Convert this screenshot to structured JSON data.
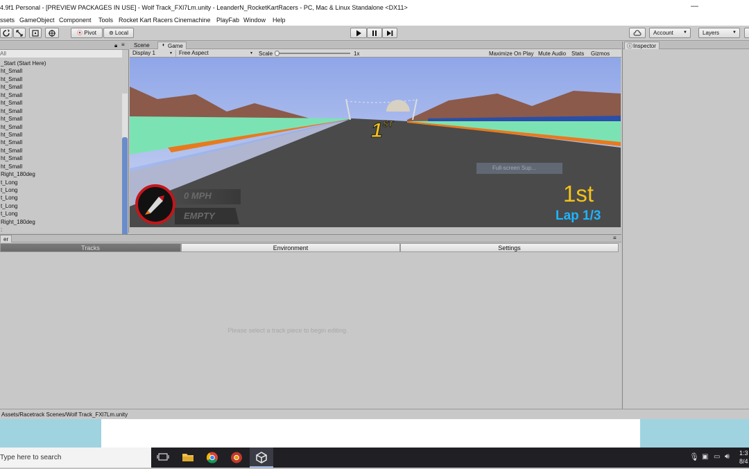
{
  "window": {
    "title": "4.9f1 Personal - [PREVIEW PACKAGES IN USE] - Wolf Track_FXl7Lm.unity - LeanderN_RocketKartRacers - PC, Mac & Linux Standalone <DX11>",
    "minimize": "—"
  },
  "menu": [
    "ssets",
    "GameObject",
    "Component",
    "Tools",
    "Rocket Kart Racers",
    "Cinemachine",
    "PlayFab",
    "Window",
    "Help"
  ],
  "toolbar": {
    "pivot_label": "Pivot",
    "local_label": "Local",
    "account_label": "Account",
    "layers_label": "Layers"
  },
  "hierarchy": {
    "search_text": "All",
    "items": [
      "_Start (Start Here)",
      "ht_Small",
      "ht_Small",
      "ht_Small",
      "ht_Small",
      "ht_Small",
      "ht_Small",
      "ht_Small",
      "ht_Small",
      "ht_Small",
      "ht_Small",
      "ht_Small",
      "ht_Small",
      "ht_Small",
      "Right_180deg",
      "t_Long",
      "t_Long",
      "t_Long",
      "t_Long",
      "t_Long",
      "Right_180deg",
      ":"
    ]
  },
  "game_view": {
    "tab_scene": "Scene",
    "tab_game": "Game",
    "display": "Display 1",
    "aspect": "Free Aspect",
    "scale_label": "Scale",
    "scale_value": "1x",
    "maximize_on_play": "Maximize On Play",
    "mute_audio": "Mute Audio",
    "stats": "Stats",
    "gizmos": "Gizmos",
    "hud": {
      "position_center": "1",
      "position_center_suffix": "ST",
      "speed": "0 MPH",
      "boost": "EMPTY",
      "position": "1st",
      "lap": "Lap 1/3",
      "hint": "Full-screen Sup..."
    }
  },
  "bottom_panel": {
    "tab": "er",
    "subtabs": [
      "Tracks",
      "Environment",
      "Settings"
    ],
    "empty_message": "Please select a track piece to begin editing."
  },
  "inspector": {
    "tab": "Inspector"
  },
  "status_bar": {
    "path": "Assets/Racetrack Scenes/Wolf Track_FXl7Lm.unity"
  },
  "taskbar": {
    "search_placeholder": "Type here to search",
    "time": "1:3",
    "date": "8/4"
  },
  "colors": {
    "hud_position": "#f4c21a",
    "hud_lap": "#1fb4ff",
    "play_bar": "#6b8cc9"
  }
}
